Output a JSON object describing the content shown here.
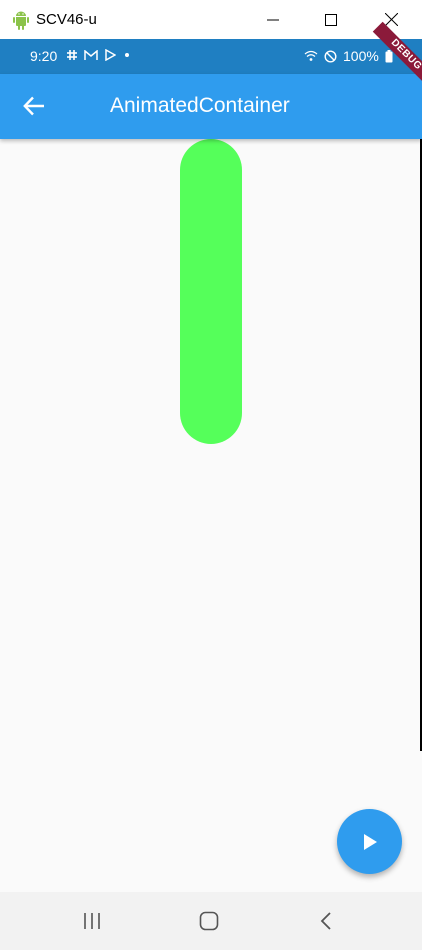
{
  "window": {
    "title": "SCV46-u",
    "app_icon": "android-icon"
  },
  "status_bar": {
    "time": "9:20",
    "battery": "100%",
    "left_icons": [
      "slack-icon",
      "gmail-icon",
      "play-store-icon",
      "dot-icon"
    ],
    "right_icons": [
      "wifi-icon",
      "do-not-disturb-icon",
      "battery-icon"
    ],
    "color": "#1f7fc2"
  },
  "debug_banner": "DEBUG",
  "app_bar": {
    "title": "AnimatedContainer",
    "back_icon": "arrow-back-icon",
    "color": "#2f9cee"
  },
  "animated_container": {
    "color": "#55ff5a"
  },
  "fab": {
    "icon": "play-icon",
    "color": "#2f9cee"
  },
  "nav_bar": {
    "buttons": [
      "recents-icon",
      "home-icon",
      "back-icon"
    ]
  }
}
